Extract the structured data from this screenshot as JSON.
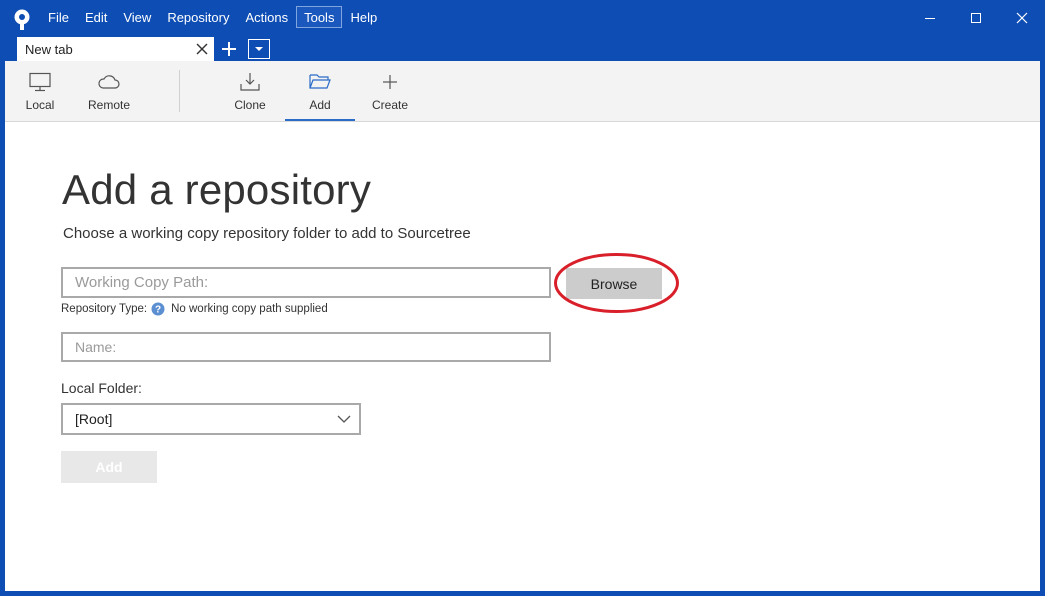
{
  "menu": {
    "items": [
      "File",
      "Edit",
      "View",
      "Repository",
      "Actions",
      "Tools",
      "Help"
    ],
    "active": "Tools"
  },
  "tabs": {
    "items": [
      {
        "label": "New tab"
      }
    ]
  },
  "toolbar": {
    "local": "Local",
    "remote": "Remote",
    "clone": "Clone",
    "add": "Add",
    "create": "Create",
    "selected": "Add"
  },
  "main": {
    "title": "Add a repository",
    "subtitle": "Choose a working copy repository folder to add to Sourcetree",
    "path_placeholder": "Working Copy Path:",
    "path_value": "",
    "browse_label": "Browse",
    "repo_type_label": "Repository Type:",
    "repo_type_value": "No working copy path supplied",
    "name_placeholder": "Name:",
    "name_value": "",
    "folder_label": "Local Folder:",
    "folder_value": "[Root]",
    "add_label": "Add"
  },
  "colors": {
    "titlebar": "#0d4db4",
    "accent": "#2a6cc8",
    "highlight": "#d9202a"
  },
  "icons": {
    "app": "sourcetree-logo-icon",
    "help": "question-circle-icon"
  }
}
